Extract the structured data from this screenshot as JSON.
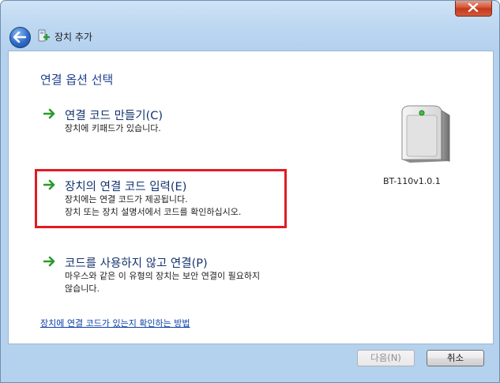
{
  "window": {
    "title": "장치 추가",
    "accent_close": "#c3391b",
    "frame_color": "#b4d1ee"
  },
  "icons": {
    "back": "back-arrow-icon",
    "title": "bluetooth-device-add-icon",
    "close": "close-icon",
    "option_arrow": "green-arrow-icon",
    "device": "device-tower-icon"
  },
  "main": {
    "heading": "연결 옵션 선택",
    "options": [
      {
        "label": "연결 코드 만들기(C)",
        "desc": [
          "장치에 키패드가 있습니다."
        ]
      },
      {
        "label": "장치의 연결 코드 입력(E)",
        "desc": [
          "장치에는 연결 코드가 제공됩니다.",
          "장치 또는 장치 설명서에서 코드를 확인하십시오."
        ]
      },
      {
        "label": "코드를 사용하지 않고 연결(P)",
        "desc": [
          "마우스와 같은 이 유형의 장치는 보안 연결이 필요하지",
          "않습니다."
        ]
      }
    ],
    "device_name": "BT-110v1.0.1",
    "help_link": "장치에 연결 코드가 있는지 확인하는 방법"
  },
  "footer": {
    "next_label": "다음(N)",
    "cancel_label": "취소"
  },
  "annotation": {
    "highlight_color": "#e11b23"
  }
}
